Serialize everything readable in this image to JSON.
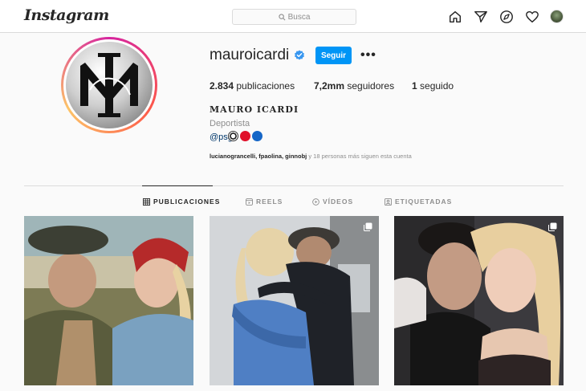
{
  "nav": {
    "logo": "Instagram",
    "search_placeholder": "Busca",
    "icons": [
      "home-icon",
      "direct-icon",
      "explore-icon",
      "activity-heart-icon",
      "profile-avatar"
    ]
  },
  "profile": {
    "username": "mauroicardi",
    "verified": true,
    "follow_label": "Seguir",
    "more_label": "•••",
    "stats": {
      "posts_value": "2.834",
      "posts_label": " publicaciones",
      "followers_value": "7,2mm",
      "followers_label": " seguidores",
      "following_value": "1",
      "following_label": " seguido"
    },
    "full_name": "MAURO ICARDI",
    "category": "Deportista",
    "bio_link": "@psg",
    "bio_emojis": [
      "soccer-ball",
      "red-circle",
      "blue-circle"
    ],
    "followed_by_names": "lucianograncelli, fpaolina, ginnobj",
    "followed_by_rest": " y 18 personas más siguen esta cuenta"
  },
  "tabs": [
    {
      "label": "PUBLICACIONES",
      "active": true
    },
    {
      "label": "REELS",
      "active": false
    },
    {
      "label": "VÍDEOS",
      "active": false
    },
    {
      "label": "ETIQUETADAS",
      "active": false
    }
  ],
  "colors": {
    "accent": "#0095f6",
    "text": "#262626",
    "muted": "#8e8e8e",
    "border": "#dbdbdb",
    "background": "#fafafa"
  },
  "posts": [
    {
      "description_icon": "photo",
      "multi": false
    },
    {
      "description_icon": "photo",
      "multi": true
    },
    {
      "description_icon": "photo",
      "multi": true
    }
  ]
}
